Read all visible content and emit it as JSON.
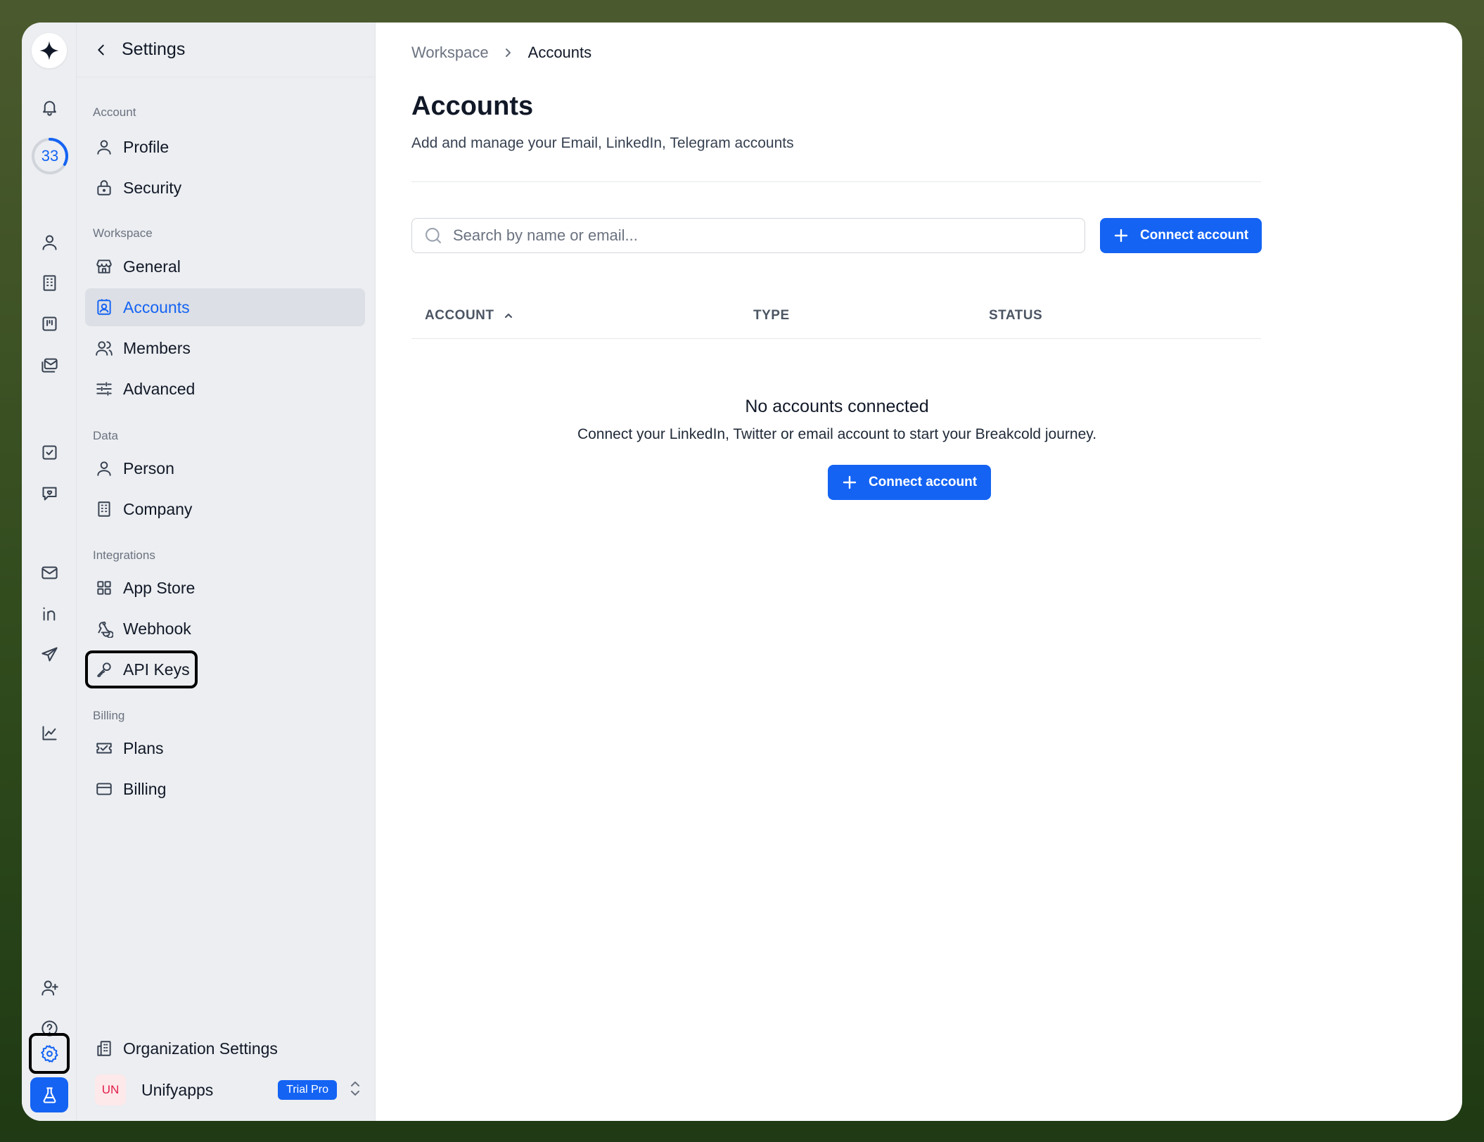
{
  "rail": {
    "progress_value": "33"
  },
  "sidebar": {
    "title": "Settings",
    "sections": {
      "account": "Account",
      "workspace": "Workspace",
      "data": "Data",
      "integrations": "Integrations",
      "billing": "Billing"
    },
    "items": {
      "profile": "Profile",
      "security": "Security",
      "general": "General",
      "accounts": "Accounts",
      "members": "Members",
      "advanced": "Advanced",
      "person": "Person",
      "company": "Company",
      "app_store": "App Store",
      "webhook": "Webhook",
      "api_keys": "API Keys",
      "plans": "Plans",
      "billing": "Billing"
    },
    "org_settings": "Organization Settings",
    "workspace": {
      "initials": "UN",
      "name": "Unifyapps",
      "badge": "Trial Pro"
    }
  },
  "breadcrumb": {
    "parent": "Workspace",
    "current": "Accounts"
  },
  "main": {
    "title": "Accounts",
    "subtitle": "Add and manage your Email, LinkedIn, Telegram accounts",
    "search_placeholder": "Search by name or email...",
    "connect_button": "Connect account",
    "columns": [
      "ACCOUNT",
      "TYPE",
      "STATUS"
    ],
    "empty_title": "No accounts connected",
    "empty_desc": "Connect your LinkedIn, Twitter or email account to start your Breakcold journey.",
    "empty_button": "Connect account"
  },
  "colors": {
    "accent": "#1463f3",
    "sidebar_bg": "#eceef1",
    "active_bg": "#dcdfe5"
  }
}
